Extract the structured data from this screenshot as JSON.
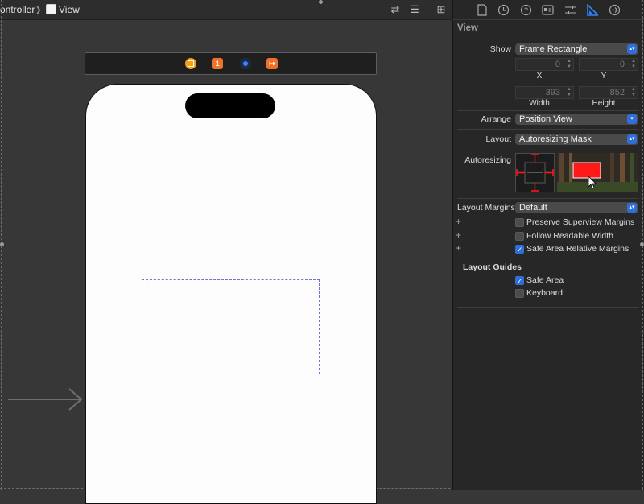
{
  "breadcrumb": {
    "controller": "ontroller",
    "separator": "❯",
    "view": "View"
  },
  "toolbar_icons": [
    "arrows-swap-icon",
    "align-lines-icon",
    "add-editor-icon"
  ],
  "scene_dock": {
    "icons": [
      {
        "name": "view-controller-icon",
        "color": "#f2a21b",
        "glyph": ""
      },
      {
        "name": "first-responder-icon",
        "color": "#f0722a",
        "glyph": "1"
      },
      {
        "name": "storyboard-reference-icon",
        "color": "#2f6fd8",
        "glyph": ""
      },
      {
        "name": "exit-icon",
        "color": "#f0722a",
        "glyph": "↦"
      }
    ]
  },
  "inspector": {
    "tabs": [
      "file-icon",
      "history-icon",
      "help-icon",
      "identity-icon",
      "attributes-icon",
      "size-icon",
      "connections-icon"
    ],
    "active_tab": "size-icon",
    "section_title": "View",
    "show_label": "Show",
    "show_value": "Frame Rectangle",
    "x_value": "0",
    "y_value": "0",
    "x_label": "X",
    "y_label": "Y",
    "width_value": "393",
    "height_value": "852",
    "width_label": "Width",
    "height_label": "Height",
    "arrange_label": "Arrange",
    "arrange_value": "Position View",
    "layout_label": "Layout",
    "layout_value": "Autoresizing Mask",
    "autoresizing_label": "Autoresizing",
    "layout_margins_label": "Layout Margins",
    "layout_margins_value": "Default",
    "checkboxes": [
      {
        "label": "Preserve Superview Margins",
        "checked": false
      },
      {
        "label": "Follow Readable Width",
        "checked": false
      },
      {
        "label": "Safe Area Relative Margins",
        "checked": true
      }
    ],
    "guides_title": "Layout Guides",
    "guides": [
      {
        "label": "Safe Area",
        "checked": true
      },
      {
        "label": "Keyboard",
        "checked": false
      }
    ],
    "plus": "+",
    "check": "✓"
  },
  "colors": {
    "accent": "#2e6fd9",
    "autoresize_red": "#ff1a1a",
    "canvas_bg": "#373737",
    "inspector_bg": "#272727"
  }
}
